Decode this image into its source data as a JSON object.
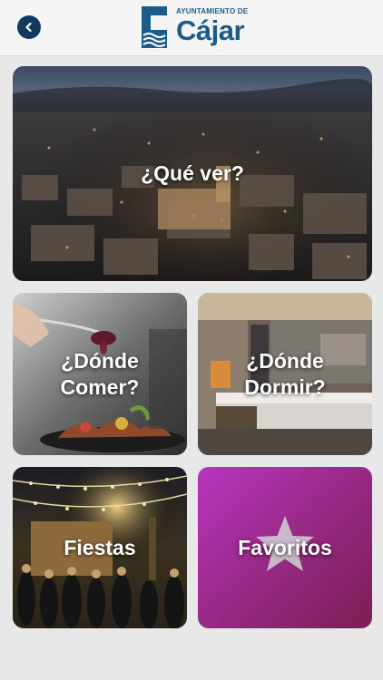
{
  "header": {
    "logo_top": "AYUNTAMIENTO DE",
    "logo_name": "Cájar",
    "back_icon": "chevron-left-icon"
  },
  "colors": {
    "brand": "#1b5b8a",
    "back_button": "#123a5c",
    "favorites_gradient_start": "#b735c0",
    "favorites_gradient_end": "#7a1f52"
  },
  "menu": {
    "que_ver": "¿Qué ver?",
    "donde_comer": "¿Dónde\nComer?",
    "donde_dormir": "¿Dónde\nDormir?",
    "fiestas": "Fiestas",
    "favoritos": "Favoritos"
  }
}
